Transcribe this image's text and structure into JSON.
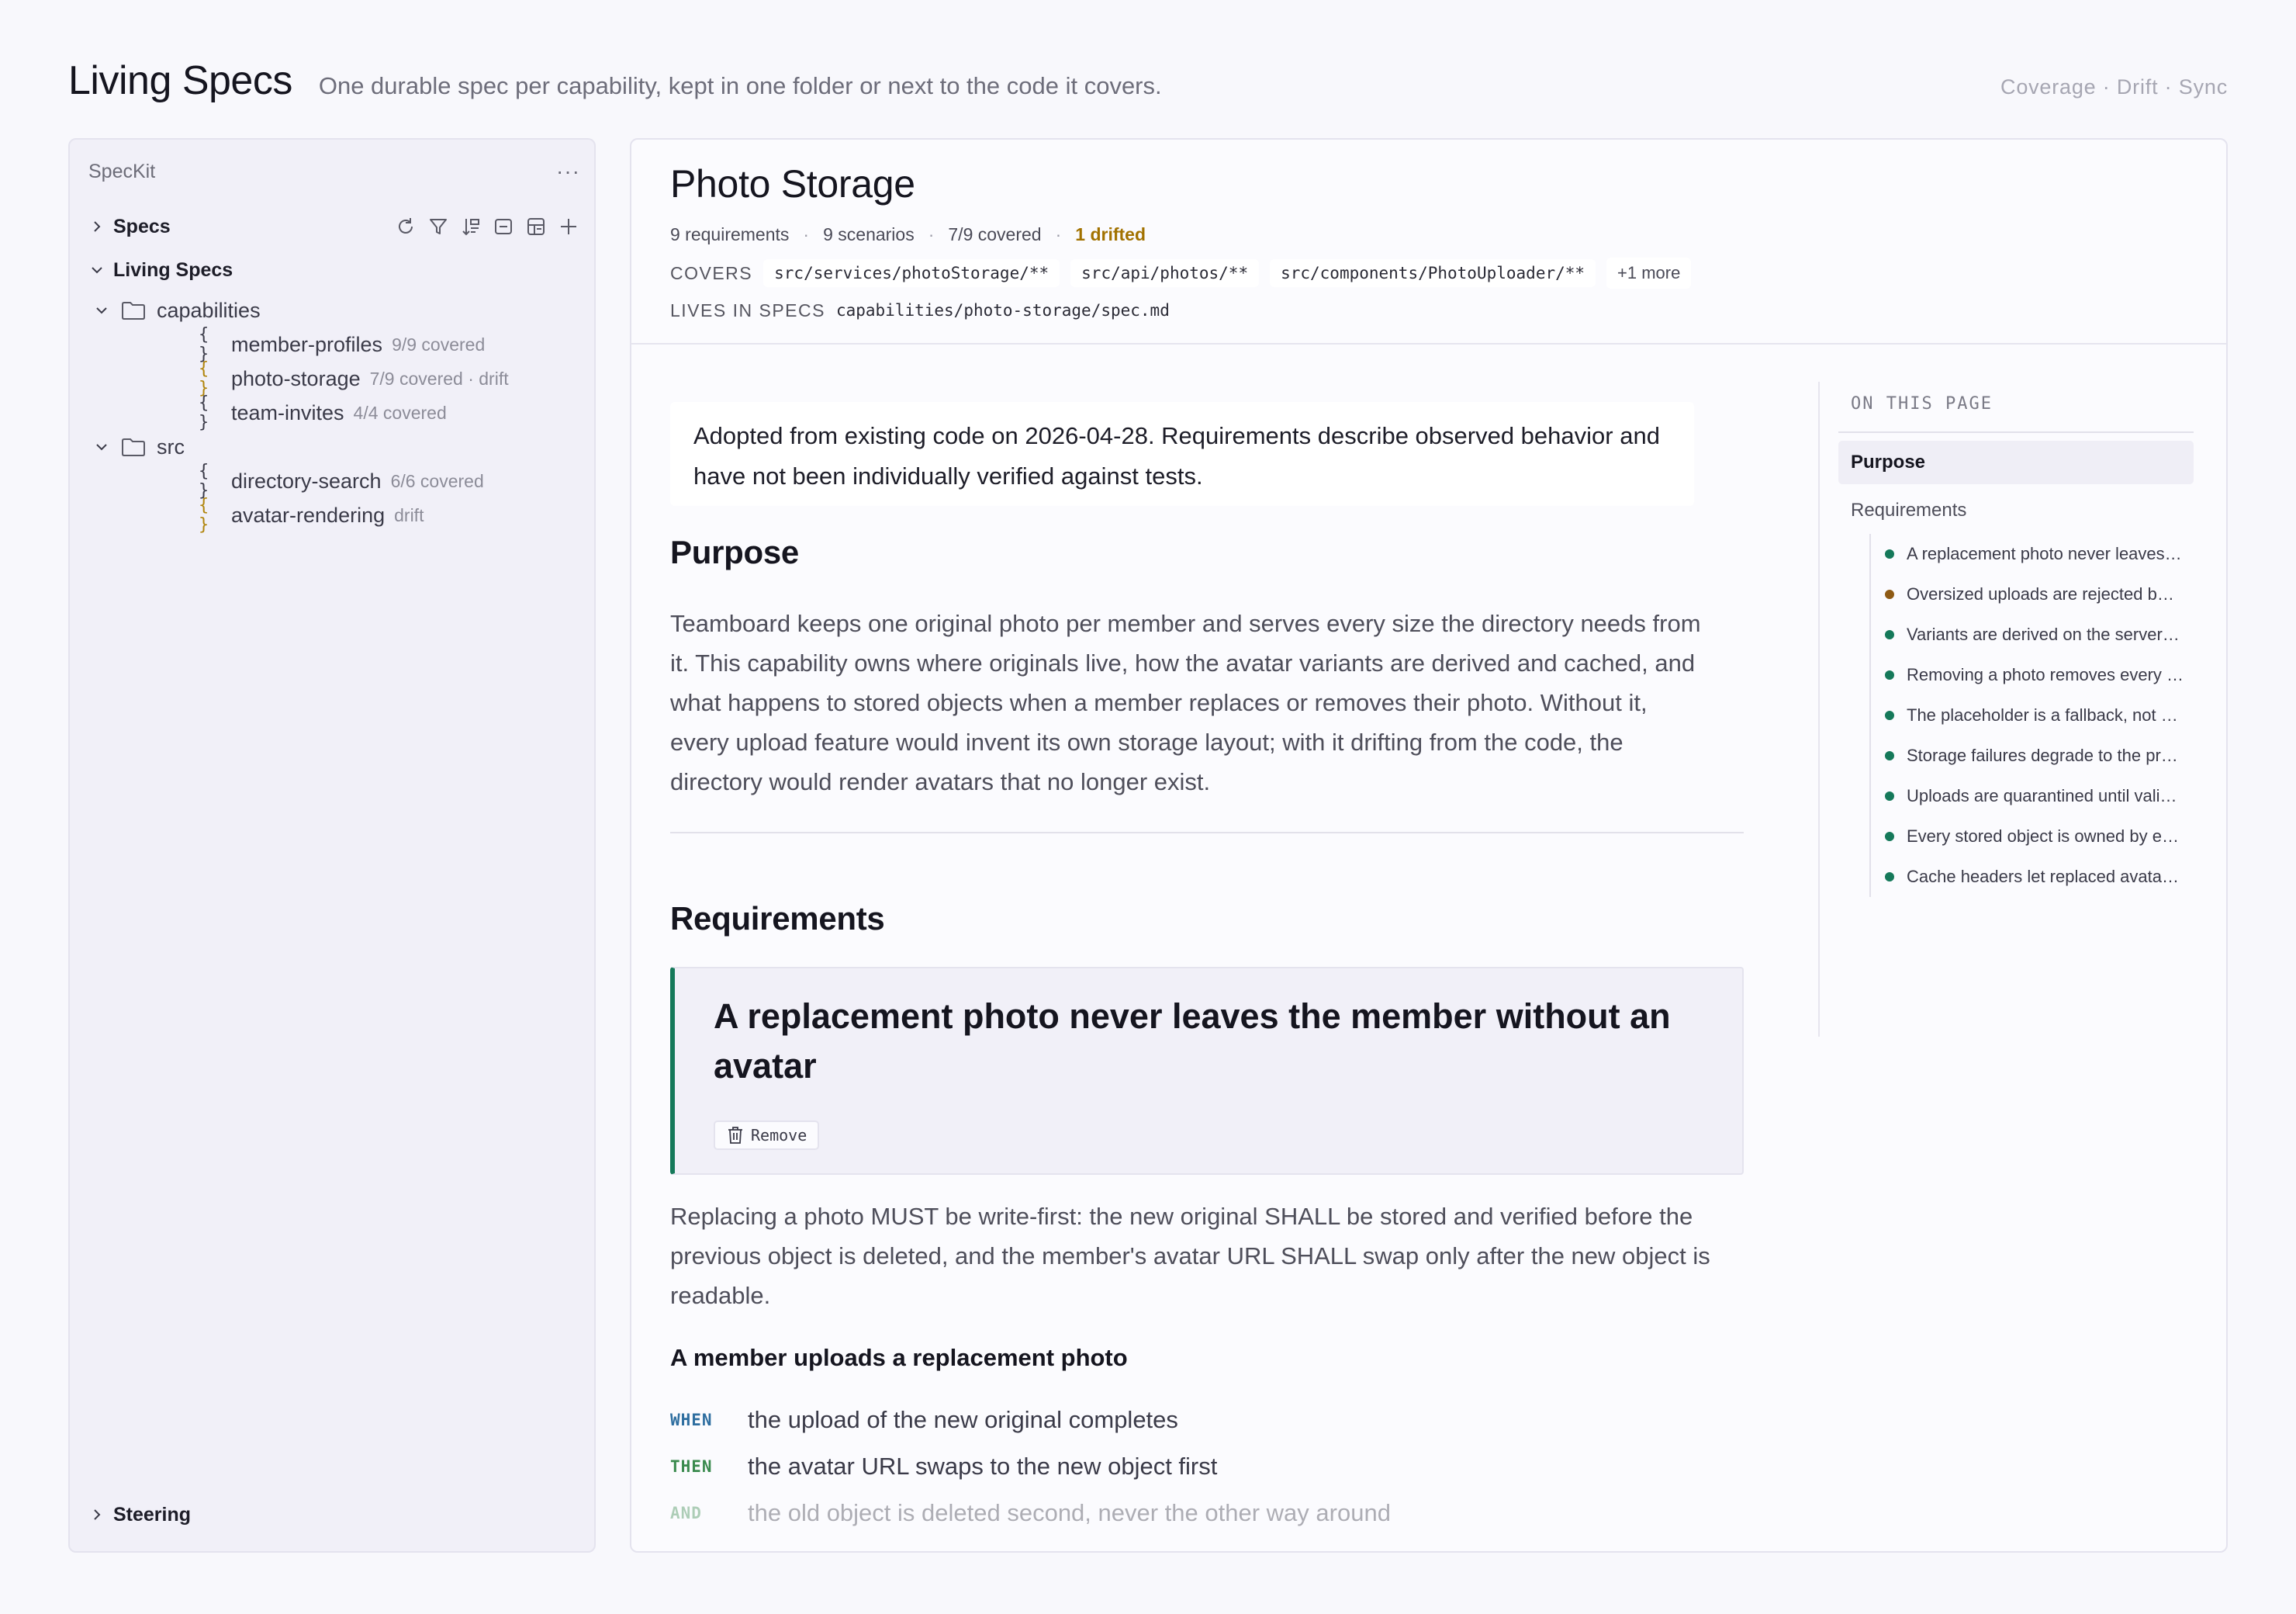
{
  "page": {
    "title": "Living Specs",
    "subtitle": "One durable spec per capability, kept in one folder or next to the code it covers.",
    "links": "Coverage · Drift · Sync"
  },
  "sidebar": {
    "brand": "SpecKit",
    "more_label": "···",
    "specs_label": "Specs",
    "living_label": "Living Specs",
    "steering_label": "Steering",
    "folders": [
      {
        "label": "capabilities",
        "items": [
          {
            "label": "member-profiles",
            "meta": "9/9 covered",
            "status": "ok"
          },
          {
            "label": "photo-storage",
            "meta": "7/9 covered · drift",
            "status": "warn"
          },
          {
            "label": "team-invites",
            "meta": "4/4 covered",
            "status": "ok"
          }
        ]
      },
      {
        "label": "src",
        "items": [
          {
            "label": "directory-search",
            "meta": "6/6 covered",
            "status": "ok"
          },
          {
            "label": "avatar-rendering",
            "meta": "drift",
            "status": "warn"
          }
        ]
      }
    ],
    "brace_glyph": "{ }"
  },
  "spec": {
    "title": "Photo Storage",
    "stats": {
      "requirements": "9 requirements",
      "scenarios": "9 scenarios",
      "covered": "7/9 covered",
      "drifted": "1 drifted",
      "sep": "·"
    },
    "covers_label": "COVERS",
    "covers": [
      "src/services/photoStorage/**",
      "src/api/photos/**",
      "src/components/PhotoUploader/**"
    ],
    "covers_more": "+1 more",
    "lives_label": "LIVES IN SPECS",
    "lives_path": "capabilities/photo-storage/spec.md",
    "notice": "Adopted from existing code on 2026-04-28. Requirements describe observed behavior and have not been individually verified against tests.",
    "purpose_heading": "Purpose",
    "purpose_text": "Teamboard keeps one original photo per member and serves every size the directory needs from it. This capability owns where originals live, how the avatar variants are derived and cached, and what happens to stored objects when a member replaces or removes their photo. Without it, every upload feature would invent its own storage layout; with it drifting from the code, the directory would render avatars that no longer exist.",
    "requirements_heading": "Requirements",
    "requirement": {
      "title": "A replacement photo never leaves the member without an avatar",
      "remove_label": "Remove",
      "text": "Replacing a photo MUST be write-first: the new original SHALL be stored and verified before the previous object is deleted, and the member's avatar URL SHALL swap only after the new object is readable.",
      "scenario_title": "A member uploads a replacement photo",
      "steps": [
        {
          "keyword": "WHEN",
          "text": "the upload of the new original completes"
        },
        {
          "keyword": "THEN",
          "text": "the avatar URL swaps to the new object first"
        },
        {
          "keyword": "AND",
          "text": "the old object is deleted second, never the other way around"
        }
      ]
    }
  },
  "toc": {
    "title": "ON THIS PAGE",
    "active": "Purpose",
    "section": "Requirements",
    "items": [
      {
        "label": "A replacement photo never leaves…",
        "status": "ok"
      },
      {
        "label": "Oversized uploads are rejected b…",
        "status": "warn"
      },
      {
        "label": "Variants are derived on the server…",
        "status": "ok"
      },
      {
        "label": "Removing a photo removes every …",
        "status": "ok"
      },
      {
        "label": "The placeholder is a fallback, not …",
        "status": "ok"
      },
      {
        "label": "Storage failures degrade to the pr…",
        "status": "ok"
      },
      {
        "label": "Uploads are quarantined until vali…",
        "status": "ok"
      },
      {
        "label": "Every stored object is owned by e…",
        "status": "ok"
      },
      {
        "label": "Cache headers let replaced avata…",
        "status": "ok"
      }
    ]
  },
  "colors": {
    "accent_green": "#15795a",
    "drift_amber": "#a27200",
    "warn_dot": "#8e5a14"
  }
}
